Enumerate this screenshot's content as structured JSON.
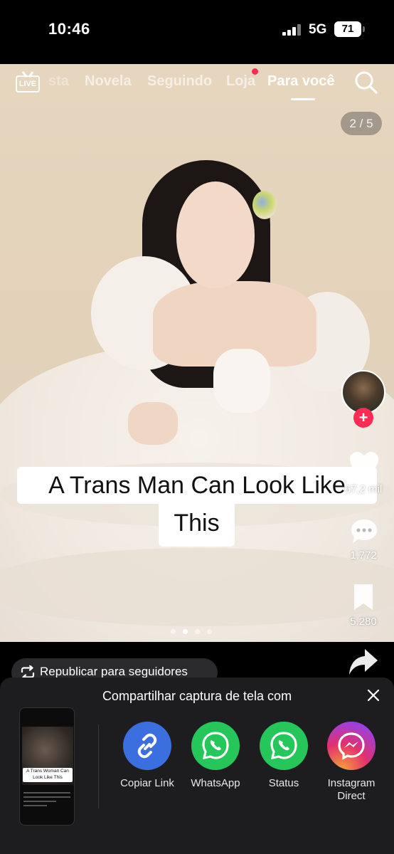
{
  "status_bar": {
    "time": "10:46",
    "network": "5G",
    "battery": "71"
  },
  "top_nav": {
    "live_label": "LIVE",
    "tabs": [
      {
        "label": "sta"
      },
      {
        "label": "Novela"
      },
      {
        "label": "Seguindo"
      },
      {
        "label": "Loja"
      },
      {
        "label": "Para você"
      }
    ],
    "active_tab": "Para você"
  },
  "post": {
    "counter": "2 / 5",
    "caption_line1": "A Trans Man Can Look Like",
    "caption_line2": "This",
    "likes": "67,2 mil",
    "comments": "1.772",
    "saves": "5.280",
    "carousel_active_index": 1,
    "carousel_total_dots": 4
  },
  "repost": {
    "label": "Republicar para seguidores"
  },
  "share_sheet": {
    "title": "Compartilhar captura de tela com",
    "thumbnail_caption": "A Trans Woman Can Look Like This",
    "options": [
      {
        "label": "Copiar Link",
        "icon": "link-icon",
        "color": "#3b6fe0"
      },
      {
        "label": "WhatsApp",
        "icon": "whatsapp-icon",
        "color": "#25c65a"
      },
      {
        "label": "Status",
        "icon": "whatsapp-status-icon",
        "color": "#25c65a"
      },
      {
        "label": "Instagram Direct",
        "icon": "messenger-icon",
        "color": "#c13584"
      }
    ]
  },
  "colors": {
    "accent": "#fe2c55",
    "sheet_bg": "#1d1d1f"
  }
}
